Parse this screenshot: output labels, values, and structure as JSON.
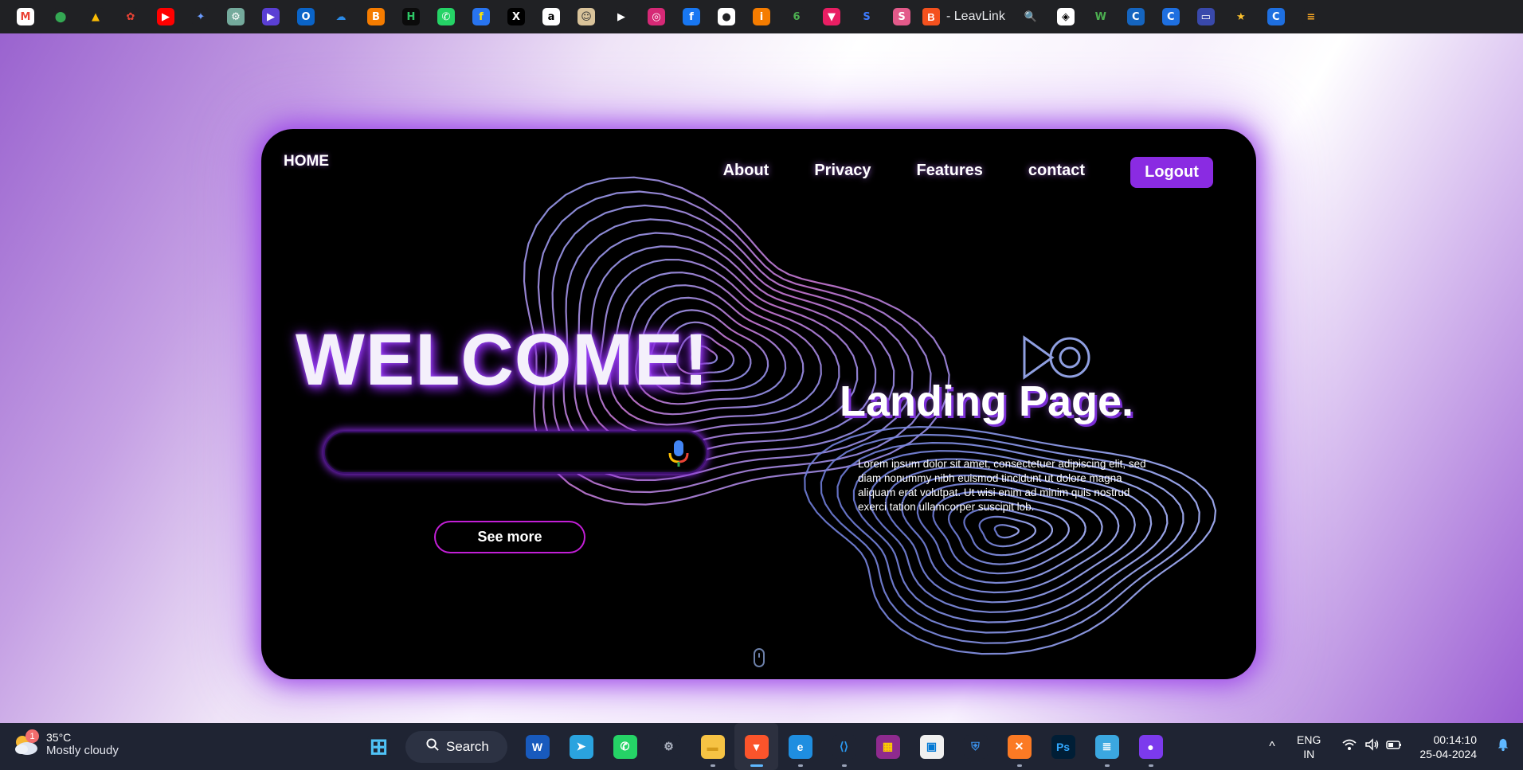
{
  "bookmarks": {
    "icons": [
      {
        "name": "gmail-icon",
        "glyph": "M",
        "bg": "#ffffff",
        "fg": "#ea4335"
      },
      {
        "name": "google-maps-icon",
        "glyph": "⬤",
        "bg": "#202124",
        "fg": "#34a853"
      },
      {
        "name": "google-drive-icon",
        "glyph": "▲",
        "bg": "#202124",
        "fg": "#fbbc04"
      },
      {
        "name": "google-photos-icon",
        "glyph": "✿",
        "bg": "#202124",
        "fg": "#ea4335"
      },
      {
        "name": "youtube-icon",
        "glyph": "▶",
        "bg": "#ff0000",
        "fg": "#ffffff"
      },
      {
        "name": "gemini-icon",
        "glyph": "✦",
        "bg": "#202124",
        "fg": "#6b9cff"
      },
      {
        "name": "chatgpt-icon",
        "glyph": "⚙",
        "bg": "#74aa9c",
        "fg": "#ffffff"
      },
      {
        "name": "copilot-icon",
        "glyph": "▶",
        "bg": "#5a3fd4",
        "fg": "#ffffff"
      },
      {
        "name": "outlook-icon",
        "glyph": "O",
        "bg": "#0a64c8",
        "fg": "#ffffff"
      },
      {
        "name": "onedrive-icon",
        "glyph": "☁",
        "bg": "#202124",
        "fg": "#2b8ae6"
      },
      {
        "name": "blogger-icon",
        "glyph": "B",
        "bg": "#f57c00",
        "fg": "#ffffff"
      },
      {
        "name": "hackerrank-icon",
        "glyph": "H",
        "bg": "#0b0b0b",
        "fg": "#2ec866"
      },
      {
        "name": "whatsapp-icon",
        "glyph": "✆",
        "bg": "#25d366",
        "fg": "#ffffff"
      },
      {
        "name": "flipkart-icon",
        "glyph": "f",
        "bg": "#2874f0",
        "fg": "#ffe500"
      },
      {
        "name": "x-twitter-icon",
        "glyph": "X",
        "bg": "#000000",
        "fg": "#ffffff"
      },
      {
        "name": "amazon-icon",
        "glyph": "a",
        "bg": "#ffffff",
        "fg": "#000000"
      },
      {
        "name": "avatar-bookmark-icon",
        "glyph": "☺",
        "bg": "#d9c39a",
        "fg": "#333333"
      },
      {
        "name": "play-icon",
        "glyph": "▶",
        "bg": "#202124",
        "fg": "#ffffff"
      },
      {
        "name": "instagram-icon",
        "glyph": "◎",
        "bg": "#d62976",
        "fg": "#ffffff"
      },
      {
        "name": "facebook-icon",
        "glyph": "f",
        "bg": "#1877f2",
        "fg": "#ffffff"
      },
      {
        "name": "github-icon",
        "glyph": "●",
        "bg": "#ffffff",
        "fg": "#202124"
      },
      {
        "name": "orange-i-icon",
        "glyph": "i",
        "bg": "#f57c00",
        "fg": "#ffffff"
      },
      {
        "name": "swirl-icon",
        "glyph": "6",
        "bg": "#202124",
        "fg": "#4caf50"
      },
      {
        "name": "pink-bookmark-icon",
        "glyph": "▼",
        "bg": "#e91e63",
        "fg": "#ffffff"
      },
      {
        "name": "s-blue-icon",
        "glyph": "S",
        "bg": "#202124",
        "fg": "#3d7bff"
      },
      {
        "name": "s-gradient-icon",
        "glyph": "S",
        "bg": "#e35a8a",
        "fg": "#ffffff"
      }
    ],
    "leavlink": {
      "glyph": "B",
      "label": "- LeavLink"
    },
    "icons_after": [
      {
        "name": "search-bookmark-icon",
        "glyph": "🔍",
        "bg": "#202124",
        "fg": "#4c8bf5"
      },
      {
        "name": "codepen-icon",
        "glyph": "◈",
        "bg": "#ffffff",
        "fg": "#000000"
      },
      {
        "name": "w-green-icon",
        "glyph": "W",
        "bg": "#202124",
        "fg": "#4caf50"
      },
      {
        "name": "cet-icon",
        "glyph": "C",
        "bg": "#1565c0",
        "fg": "#ffffff"
      },
      {
        "name": "c-blue-icon",
        "glyph": "C",
        "bg": "#1e6fe0",
        "fg": "#ffffff"
      },
      {
        "name": "window-icon",
        "glyph": "▭",
        "bg": "#3949ab",
        "fg": "#ffffff"
      },
      {
        "name": "star-face-icon",
        "glyph": "★",
        "bg": "#202124",
        "fg": "#fbc02d"
      },
      {
        "name": "c-blue-2-icon",
        "glyph": "C",
        "bg": "#1e6fe0",
        "fg": "#ffffff"
      },
      {
        "name": "stack-icon",
        "glyph": "≡",
        "bg": "#202124",
        "fg": "#f9a825"
      }
    ]
  },
  "landing": {
    "nav": {
      "home": "HOME",
      "items": [
        "About",
        "Privacy",
        "Features",
        "contact"
      ],
      "logout": "Logout"
    },
    "welcome": "WELCOME!",
    "search_placeholder": "",
    "see_more": "See more",
    "title": "Landing Page.",
    "body": "Lorem ipsum dolor sit amet, consectetuer adipiscing elit, sed diam nonummy nibh euismod tincidunt ut dolore magna aliquam erat volutpat. Ut wisi enim ad minim quis nostrud exerci tation ullamcorper suscipit lob."
  },
  "taskbar": {
    "weather": {
      "badge": "1",
      "temp": "35°C",
      "condition": "Mostly cloudy"
    },
    "search_label": "Search",
    "apps": [
      {
        "name": "start-button",
        "glyph": "⊞",
        "bg": "#1f2433",
        "fg": "#4fc3f7",
        "active": false,
        "dot": false
      },
      {
        "name": "word-app-icon",
        "glyph": "W",
        "bg": "#185abd",
        "fg": "#ffffff",
        "active": false,
        "dot": false
      },
      {
        "name": "telegram-app-icon",
        "glyph": "➤",
        "bg": "#2aa3df",
        "fg": "#ffffff",
        "active": false,
        "dot": false
      },
      {
        "name": "whatsapp-app-icon",
        "glyph": "✆",
        "bg": "#25d366",
        "fg": "#ffffff",
        "active": false,
        "dot": false
      },
      {
        "name": "settings-app-icon",
        "glyph": "⚙",
        "bg": "#1f2433",
        "fg": "#b0b6c4",
        "active": false,
        "dot": false
      },
      {
        "name": "file-explorer-app-icon",
        "glyph": "▬",
        "bg": "#f6c344",
        "fg": "#d49a1a",
        "active": false,
        "dot": true
      },
      {
        "name": "brave-app-icon",
        "glyph": "▼",
        "bg": "#fb542b",
        "fg": "#ffffff",
        "active": true,
        "dot": true
      },
      {
        "name": "edge-app-icon",
        "glyph": "e",
        "bg": "#1f8ee0",
        "fg": "#ffffff",
        "active": false,
        "dot": true
      },
      {
        "name": "vscode-app-icon",
        "glyph": "⟨⟩",
        "bg": "#1f2433",
        "fg": "#2b9af3",
        "active": false,
        "dot": true
      },
      {
        "name": "winrar-app-icon",
        "glyph": "▦",
        "bg": "#8e2a8e",
        "fg": "#ffcc00",
        "active": false,
        "dot": false
      },
      {
        "name": "store-app-icon",
        "glyph": "▣",
        "bg": "#f0f0f0",
        "fg": "#0078d4",
        "active": false,
        "dot": false
      },
      {
        "name": "defender-app-icon",
        "glyph": "⛨",
        "bg": "#1f2433",
        "fg": "#3a8ee6",
        "active": false,
        "dot": false
      },
      {
        "name": "xampp-app-icon",
        "glyph": "✕",
        "bg": "#fb7a24",
        "fg": "#ffffff",
        "active": false,
        "dot": true
      },
      {
        "name": "photoshop-app-icon",
        "glyph": "Ps",
        "bg": "#001e36",
        "fg": "#31a8ff",
        "active": false,
        "dot": false
      },
      {
        "name": "notepad-app-icon",
        "glyph": "≣",
        "bg": "#3ba7e0",
        "fg": "#ffffff",
        "active": false,
        "dot": true
      },
      {
        "name": "github-desktop-app-icon",
        "glyph": "●",
        "bg": "#7c3aed",
        "fg": "#ffffff",
        "active": false,
        "dot": true
      }
    ],
    "tray": {
      "chevron": "^",
      "lang": "ENG",
      "region": "IN",
      "time": "00:14:10",
      "date": "25-04-2024"
    }
  }
}
